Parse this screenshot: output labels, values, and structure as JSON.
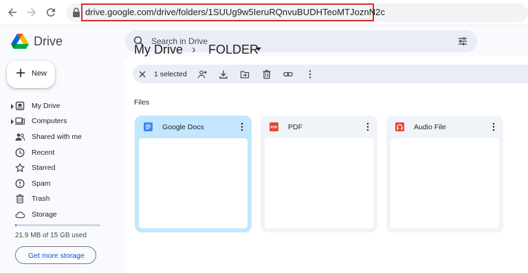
{
  "browser": {
    "url": "drive.google.com/drive/folders/1SUUg9w5IeruRQnvuBUDHTeoMTJoznN2c"
  },
  "app": {
    "name": "Drive",
    "search_placeholder": "Search in Drive",
    "new_label": "New"
  },
  "sidebar": {
    "items": [
      {
        "label": "My Drive",
        "icon": "my-drive-icon"
      },
      {
        "label": "Computers",
        "icon": "computers-icon"
      },
      {
        "label": "Shared with me",
        "icon": "shared-icon"
      },
      {
        "label": "Recent",
        "icon": "clock-icon"
      },
      {
        "label": "Starred",
        "icon": "star-icon"
      },
      {
        "label": "Spam",
        "icon": "spam-icon"
      },
      {
        "label": "Trash",
        "icon": "trash-icon"
      },
      {
        "label": "Storage",
        "icon": "cloud-icon"
      }
    ],
    "storage_used_fraction": 0.0015,
    "storage_text": "21.9 MB of 15 GB used",
    "get_storage_label": "Get more storage"
  },
  "breadcrumb": {
    "root": "My Drive",
    "separator": "›",
    "current": "FOLDER"
  },
  "selection": {
    "count_label": "1 selected"
  },
  "files_section": {
    "title": "Files",
    "files": [
      {
        "name": "Google Docs",
        "icon": "docs-icon",
        "selected": true,
        "icon_color": "#4285f4"
      },
      {
        "name": "PDF",
        "icon": "pdf-icon",
        "selected": false,
        "icon_color": "#ea4335"
      },
      {
        "name": "Audio File",
        "icon": "audio-icon",
        "selected": false,
        "icon_color": "#ea4335"
      }
    ]
  },
  "colors": {
    "accent": "#0b57d0",
    "selected_card": "#c2e7ff",
    "url_highlight": "#d32f2f"
  }
}
